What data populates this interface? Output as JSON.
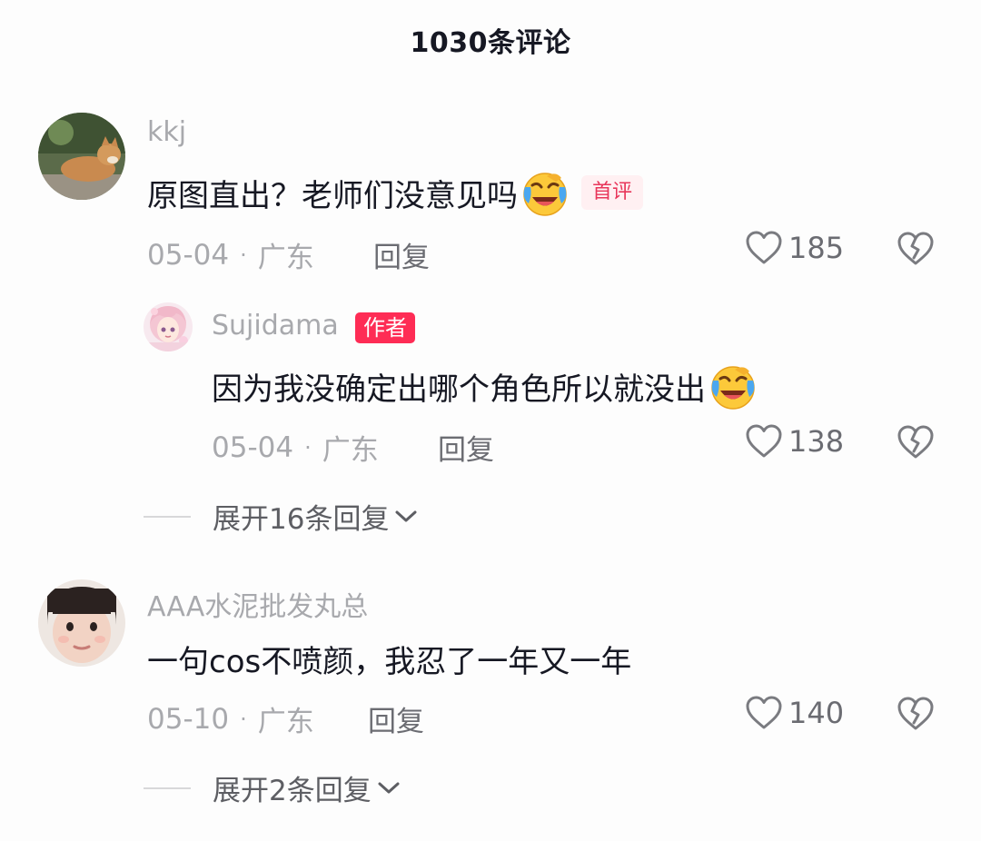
{
  "header": {
    "title": "1030条评论"
  },
  "comments": [
    {
      "username": "kkj",
      "text": "原图直出？老师们没意见吗",
      "emoji": "laughing-crying-emoji",
      "badge": "首评",
      "date": "05-04",
      "location": "广东",
      "reply_label": "回复",
      "likes": "185",
      "reply": {
        "username": "Sujidama",
        "badge": "作者",
        "text": "因为我没确定出哪个角色所以就没出",
        "emoji": "laughing-crying-emoji",
        "date": "05-04",
        "location": "广东",
        "reply_label": "回复",
        "likes": "138"
      },
      "expand_label": "展开16条回复"
    },
    {
      "username": "AAA水泥批发丸总",
      "text": "一句cos不喷颜，我忍了一年又一年",
      "date": "05-10",
      "location": "广东",
      "reply_label": "回复",
      "likes": "140",
      "expand_label": "展开2条回复"
    }
  ],
  "meta_separator": "·",
  "icons": {
    "like": "heart-outline-icon",
    "dislike": "broken-heart-icon",
    "expand": "chevron-down-icon"
  },
  "colors": {
    "text_primary": "#161823",
    "text_secondary": "#a8a9ad",
    "author_badge": "#fe2c55",
    "first_badge_text": "#e8365a",
    "first_badge_bg": "#fff0f2"
  }
}
